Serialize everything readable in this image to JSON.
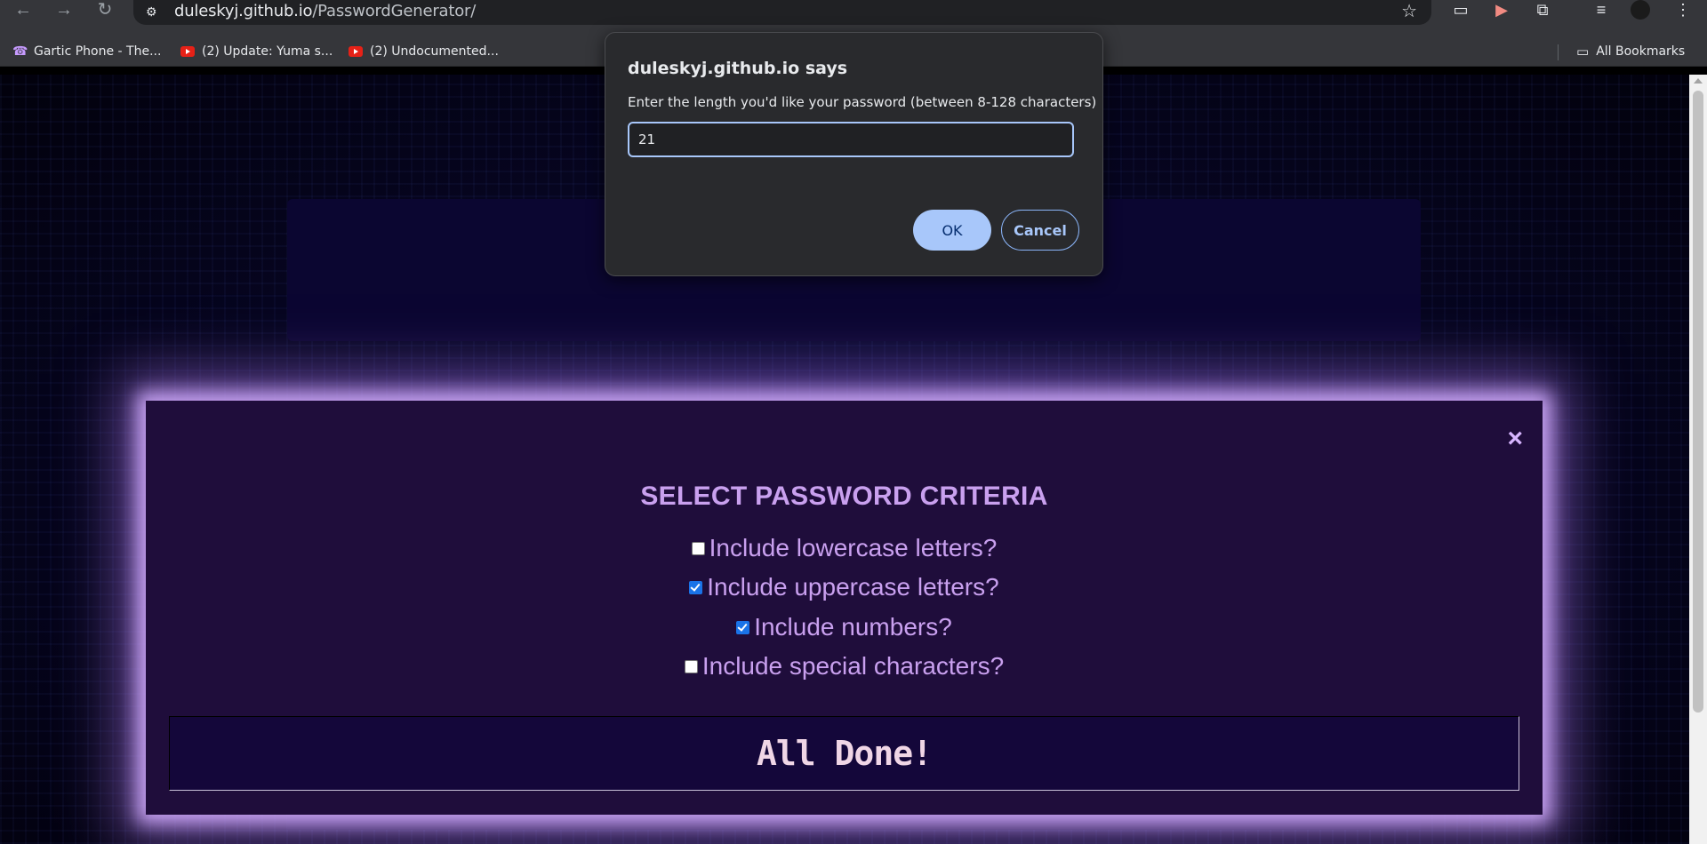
{
  "browser": {
    "url_host": "duleskyj.github.io",
    "url_path": "/PasswordGenerator/",
    "bookmarks": [
      {
        "label": "Gartic Phone - The...",
        "icon": "phone-icon"
      },
      {
        "label": "(2) Update: Yuma s...",
        "icon": "youtube-icon"
      },
      {
        "label": "(2) Undocumented...",
        "icon": "youtube-icon"
      }
    ],
    "all_bookmarks_label": "All Bookmarks"
  },
  "dialog": {
    "title": "duleskyj.github.io says",
    "message": "Enter the length you'd like your password (between 8-128 characters)",
    "input_value": "21",
    "ok_label": "OK",
    "cancel_label": "Cancel"
  },
  "modal": {
    "close_symbol": "×",
    "title": "SELECT PASSWORD CRITERIA",
    "criteria": [
      {
        "label": "Include lowercase letters?",
        "checked": false
      },
      {
        "label": "Include uppercase letters?",
        "checked": true
      },
      {
        "label": "Include numbers?",
        "checked": true
      },
      {
        "label": "Include special characters?",
        "checked": false
      }
    ],
    "done_label": "All Done!"
  },
  "colors": {
    "modal_bg": "#1f0d3b",
    "modal_glow": "#c7a3f2",
    "criteria_text": "#c9a0ef",
    "dialog_accent": "#a8c7fa"
  }
}
